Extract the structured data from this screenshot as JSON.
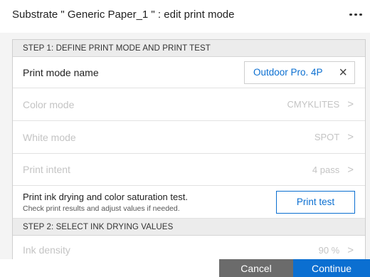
{
  "header": {
    "title": "Substrate \" Generic Paper_1 \" : edit print mode",
    "menu_icon": "more-horizontal-icon"
  },
  "step1": {
    "title": "STEP 1: DEFINE PRINT MODE AND PRINT TEST",
    "print_mode_name": {
      "label": "Print mode name",
      "value": "Outdoor Pro. 4P",
      "clear_icon": "close-icon"
    },
    "color_mode": {
      "label": "Color mode",
      "value": "CMYKLITES"
    },
    "white_mode": {
      "label": "White mode",
      "value": "SPOT"
    },
    "print_intent": {
      "label": "Print intent",
      "value": "4 pass"
    },
    "test": {
      "title": "Print ink drying and color saturation test.",
      "subtitle": "Check print results and adjust values if needed.",
      "button_label": "Print test"
    }
  },
  "step2": {
    "title": "STEP 2: SELECT INK DRYING VALUES",
    "ink_density": {
      "label": "Ink density",
      "value": "90 %"
    }
  },
  "footer": {
    "cancel_label": "Cancel",
    "continue_label": "Continue"
  },
  "colors": {
    "accent": "#0b6fd1",
    "cancel_bg": "#6b6b6b",
    "disabled_text": "#c4c4c4"
  }
}
